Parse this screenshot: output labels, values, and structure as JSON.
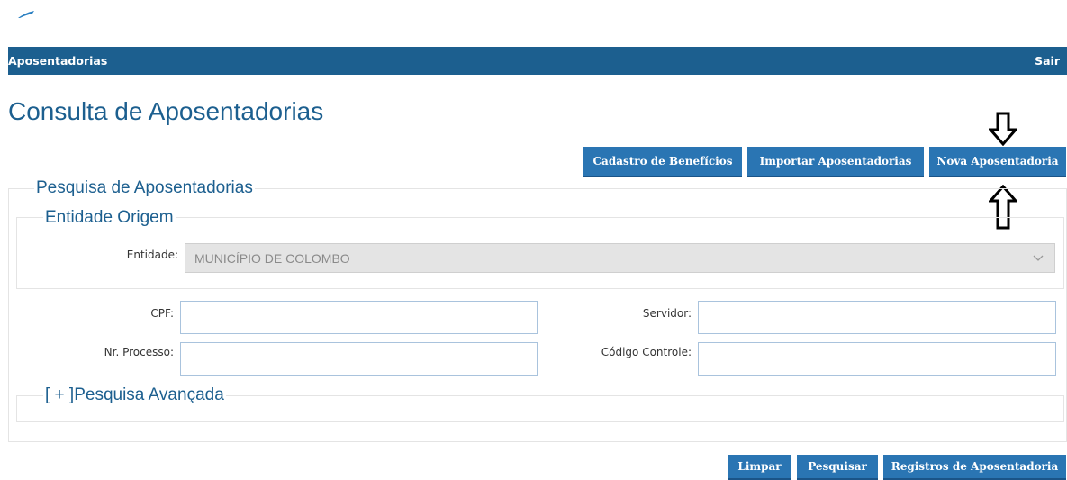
{
  "header": {
    "title": "Aposentadorias",
    "logout": "Sair"
  },
  "page": {
    "title": "Consulta de Aposentadorias"
  },
  "actions": {
    "cadastro": "Cadastro de Benefícios",
    "importar": "Importar Aposentadorias",
    "nova": "Nova Aposentadoria"
  },
  "search": {
    "legend": "Pesquisa de Aposentadorias",
    "origem": {
      "legend": "Entidade Origem",
      "entidade_label": "Entidade:",
      "entidade_value": "MUNICÍPIO DE COLOMBO"
    },
    "cpf_label": "CPF:",
    "servidor_label": "Servidor:",
    "processo_label": "Nr. Processo:",
    "codigo_label": "Código Controle:",
    "advanced_legend": "[ + ]Pesquisa Avançada"
  },
  "footer": {
    "limpar": "Limpar",
    "pesquisar": "Pesquisar",
    "registros": "Registros de Aposentadoria"
  },
  "colors": {
    "header_bg": "#1c5f8f",
    "button_bg": "#2a75b3",
    "title": "#1c5f8f"
  },
  "icons": {
    "annotation_down": "arrow-down-outline-icon",
    "annotation_up": "arrow-up-outline-icon",
    "dropdown": "chevron-down-icon"
  }
}
